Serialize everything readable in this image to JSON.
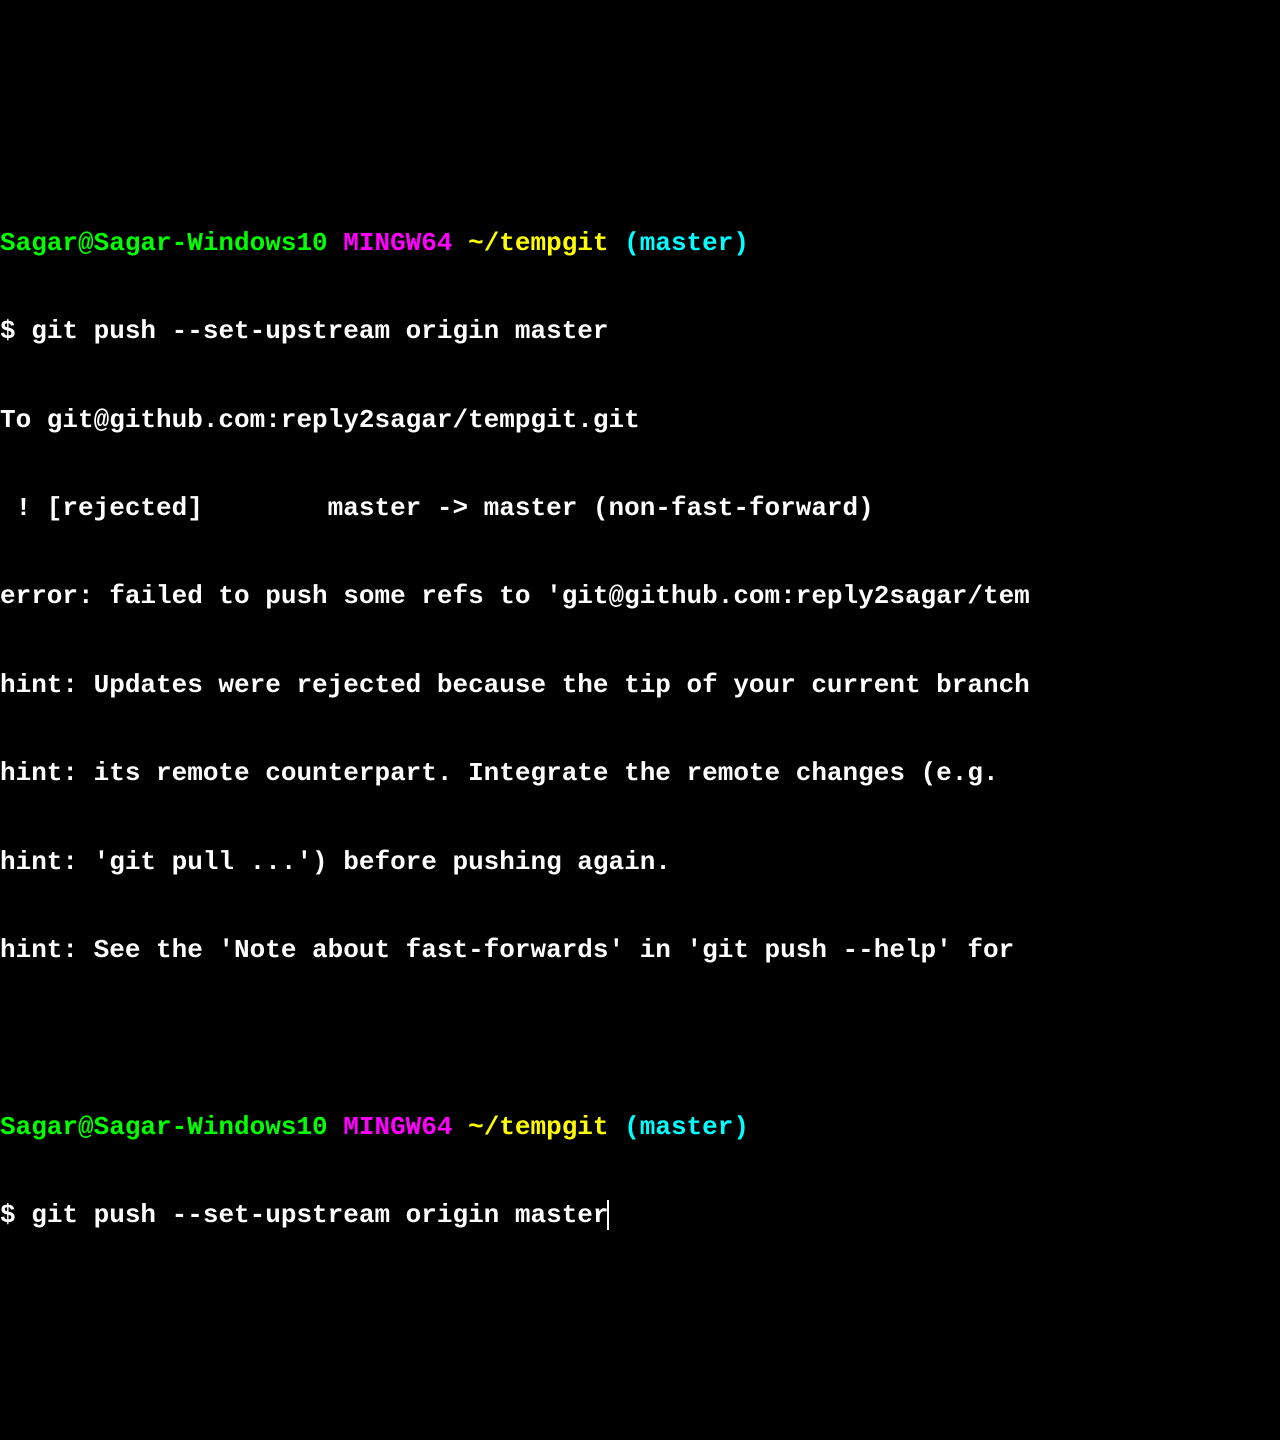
{
  "prompt1": {
    "user_host": "Sagar@Sagar-Windows10",
    "mingw": "MINGW64",
    "path": "~/tempgit",
    "branch": "(master)"
  },
  "command1": " git push --set-upstream origin master",
  "output": {
    "to_line": "To git@github.com:reply2sagar/tempgit.git",
    "rejected": " ! [rejected]        master -> master (non-fast-forward)",
    "error": "error: failed to push some refs to 'git@github.com:reply2sagar/tem",
    "hint1": "hint: Updates were rejected because the tip of your current branch",
    "hint2": "hint: its remote counterpart. Integrate the remote changes (e.g.",
    "hint3": "hint: 'git pull ...') before pushing again.",
    "hint4": "hint: See the 'Note about fast-forwards' in 'git push --help' for"
  },
  "prompt2": {
    "user_host": "Sagar@Sagar-Windows10",
    "mingw": "MINGW64",
    "path": "~/tempgit",
    "branch": "(master)"
  },
  "command2": " git push --set-upstream origin master"
}
